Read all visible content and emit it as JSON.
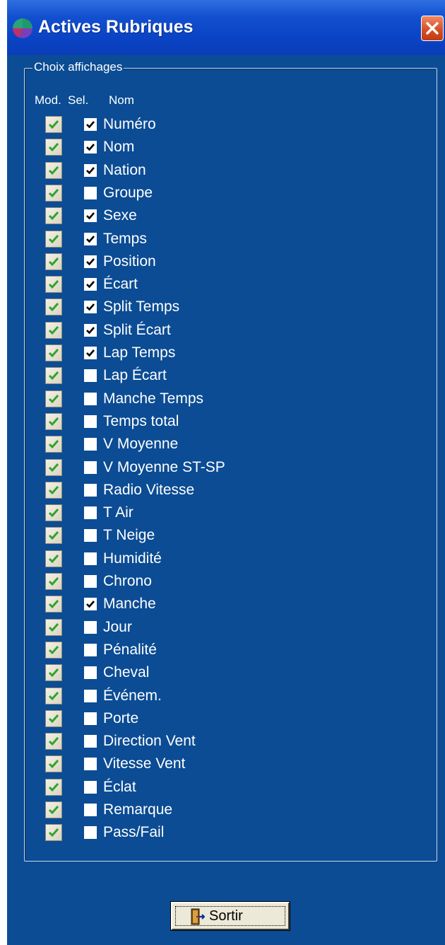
{
  "window": {
    "title": "Actives Rubriques",
    "colors": {
      "background": "#0b4c94",
      "titlebar": "#0a43c4",
      "close": "#d84f25",
      "modCheck": "#2fa32f"
    }
  },
  "group": {
    "legend": "Choix affichages",
    "headers": {
      "mod": "Mod.",
      "sel": "Sel.",
      "nom": "Nom"
    }
  },
  "items": [
    {
      "label": "Numéro",
      "mod": true,
      "sel": true
    },
    {
      "label": "Nom",
      "mod": true,
      "sel": true
    },
    {
      "label": "Nation",
      "mod": true,
      "sel": true
    },
    {
      "label": "Groupe",
      "mod": true,
      "sel": false
    },
    {
      "label": "Sexe",
      "mod": true,
      "sel": true
    },
    {
      "label": "Temps",
      "mod": true,
      "sel": true
    },
    {
      "label": "Position",
      "mod": true,
      "sel": true
    },
    {
      "label": "Écart",
      "mod": true,
      "sel": true
    },
    {
      "label": "Split Temps",
      "mod": true,
      "sel": true
    },
    {
      "label": "Split Écart",
      "mod": true,
      "sel": true
    },
    {
      "label": "Lap Temps",
      "mod": true,
      "sel": true
    },
    {
      "label": "Lap Écart",
      "mod": true,
      "sel": false
    },
    {
      "label": "Manche Temps",
      "mod": true,
      "sel": false
    },
    {
      "label": "Temps total",
      "mod": true,
      "sel": false
    },
    {
      "label": "V Moyenne",
      "mod": true,
      "sel": false
    },
    {
      "label": "V Moyenne ST-SP",
      "mod": true,
      "sel": false
    },
    {
      "label": "Radio Vitesse",
      "mod": true,
      "sel": false
    },
    {
      "label": "T Air",
      "mod": true,
      "sel": false
    },
    {
      "label": "T Neige",
      "mod": true,
      "sel": false
    },
    {
      "label": "Humidité",
      "mod": true,
      "sel": false
    },
    {
      "label": "Chrono",
      "mod": true,
      "sel": false
    },
    {
      "label": "Manche",
      "mod": true,
      "sel": true
    },
    {
      "label": "Jour",
      "mod": true,
      "sel": false
    },
    {
      "label": "Pénalité",
      "mod": true,
      "sel": false
    },
    {
      "label": "Cheval",
      "mod": true,
      "sel": false
    },
    {
      "label": "Événem.",
      "mod": true,
      "sel": false
    },
    {
      "label": "Porte",
      "mod": true,
      "sel": false
    },
    {
      "label": "Direction Vent",
      "mod": true,
      "sel": false
    },
    {
      "label": "Vitesse Vent",
      "mod": true,
      "sel": false
    },
    {
      "label": "Éclat",
      "mod": true,
      "sel": false
    },
    {
      "label": "Remarque",
      "mod": true,
      "sel": false
    },
    {
      "label": "Pass/Fail",
      "mod": true,
      "sel": false
    }
  ],
  "footer": {
    "sortir_label": "Sortir",
    "sortir_icon": "exit-door-icon"
  }
}
